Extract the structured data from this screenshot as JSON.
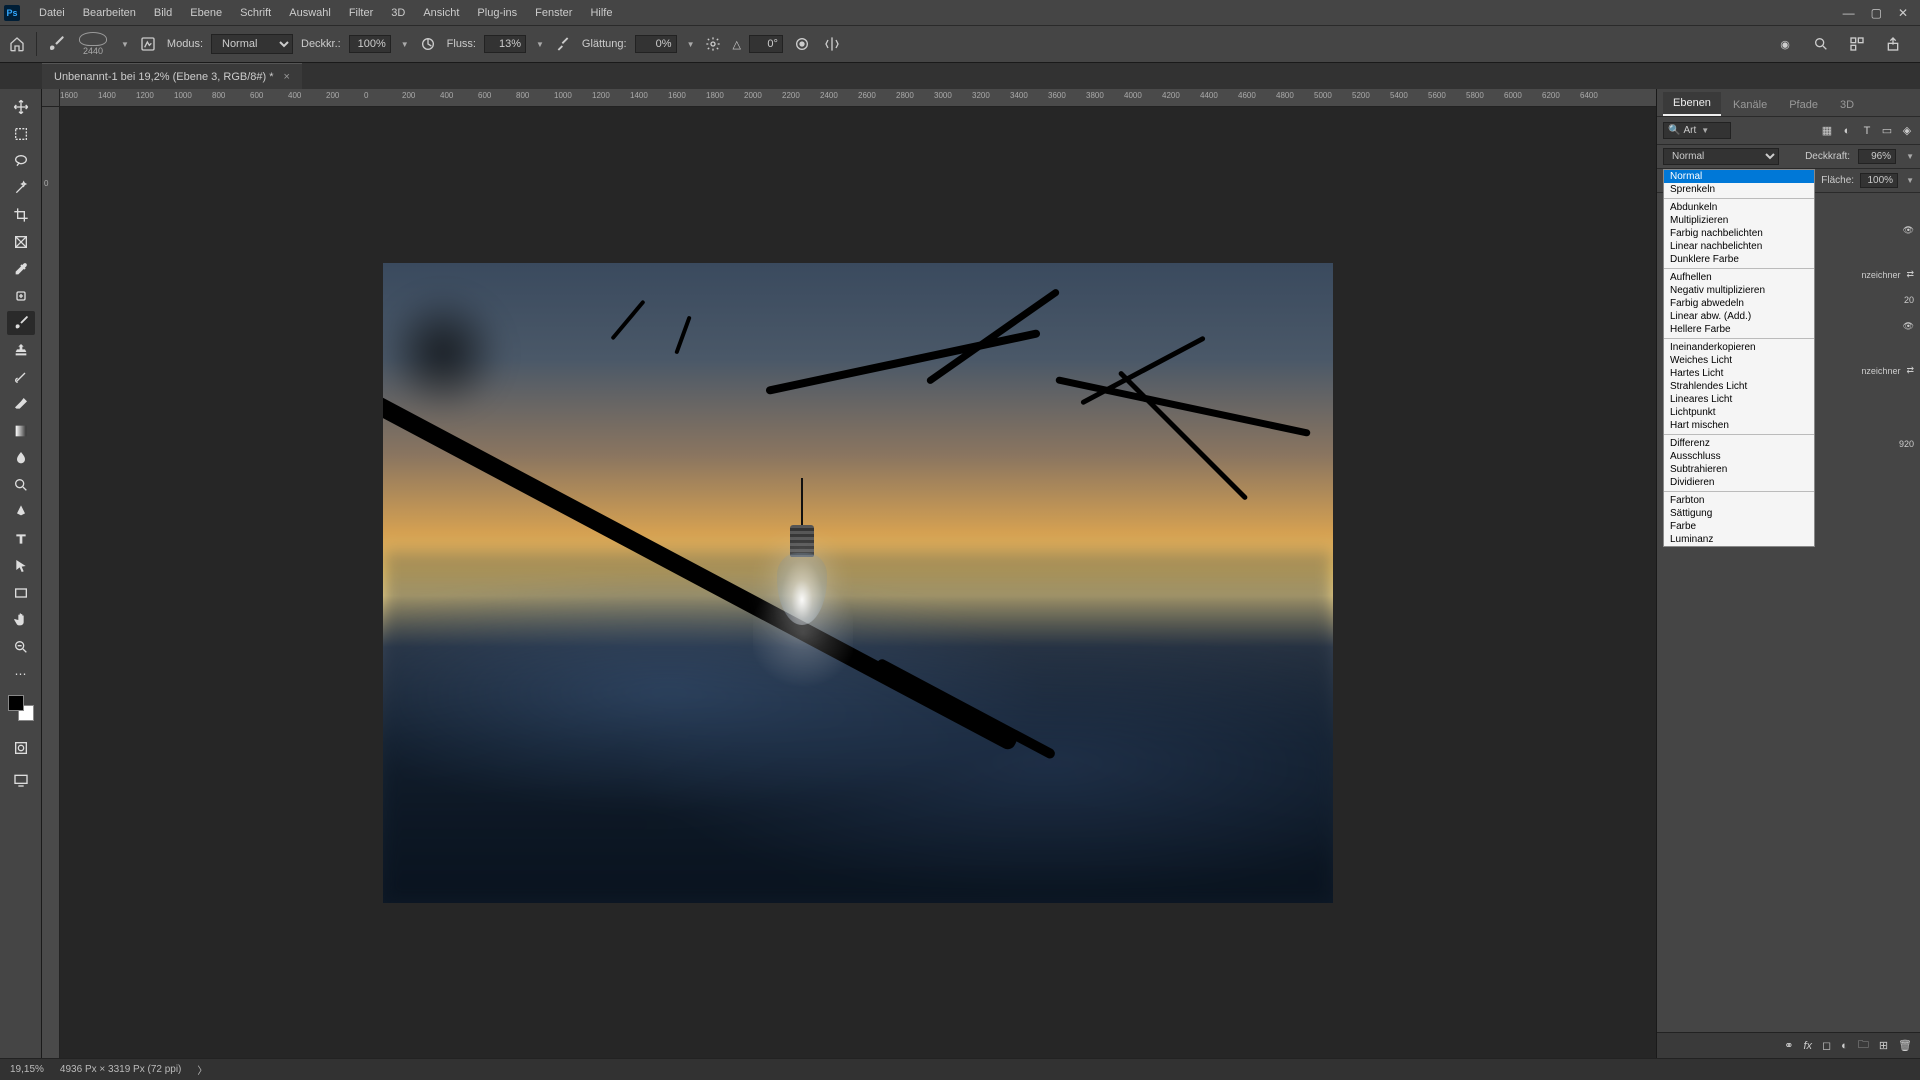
{
  "menubar": {
    "items": [
      "Datei",
      "Bearbeiten",
      "Bild",
      "Ebene",
      "Schrift",
      "Auswahl",
      "Filter",
      "3D",
      "Ansicht",
      "Plug-ins",
      "Fenster",
      "Hilfe"
    ]
  },
  "optionsbar": {
    "brush_size": "2440",
    "mode_label": "Modus:",
    "mode_value": "Normal",
    "opacity_label": "Deckkr.:",
    "opacity_value": "100%",
    "flow_label": "Fluss:",
    "flow_value": "13%",
    "smoothing_label": "Glättung:",
    "smoothing_value": "0%",
    "angle_label": "△",
    "angle_value": "0°"
  },
  "doctab": {
    "title": "Unbenannt-1 bei 19,2% (Ebene 3, RGB/8#) *"
  },
  "ruler_ticks_h": [
    "1600",
    "1400",
    "1200",
    "1000",
    "800",
    "600",
    "400",
    "200",
    "0",
    "200",
    "400",
    "600",
    "800",
    "1000",
    "1200",
    "1400",
    "1600",
    "1800",
    "2000",
    "2200",
    "2400",
    "2600",
    "2800",
    "3000",
    "3200",
    "3400",
    "3600",
    "3800",
    "4000",
    "4200",
    "4400",
    "4600",
    "4800",
    "5000",
    "5200",
    "5400",
    "5600",
    "5800",
    "6000",
    "6200",
    "6400"
  ],
  "ruler_ticks_v": [
    "0"
  ],
  "panels": {
    "tabs": [
      "Ebenen",
      "Kanäle",
      "Pfade",
      "3D"
    ],
    "active_tab": 0,
    "search_placeholder": "Art",
    "blend_current": "Normal",
    "opacity_label": "Deckkraft:",
    "opacity_value": "96%",
    "fill_label": "Fläche:",
    "fill_value": "100%",
    "blend_options": [
      [
        "Normal",
        "Sprenkeln"
      ],
      [
        "Abdunkeln",
        "Multiplizieren",
        "Farbig nachbelichten",
        "Linear nachbelichten",
        "Dunklere Farbe"
      ],
      [
        "Aufhellen",
        "Negativ multiplizieren",
        "Farbig abwedeln",
        "Linear abw. (Add.)",
        "Hellere Farbe"
      ],
      [
        "Ineinanderkopieren",
        "Weiches Licht",
        "Hartes Licht",
        "Strahlendes Licht",
        "Lineares Licht",
        "Lichtpunkt",
        "Hart mischen"
      ],
      [
        "Differenz",
        "Ausschluss",
        "Subtrahieren",
        "Dividieren"
      ],
      [
        "Farbton",
        "Sättigung",
        "Farbe",
        "Luminanz"
      ]
    ],
    "peek_labels": {
      "a": "nzeichner",
      "b": "20",
      "c": "nzeichner",
      "d": "920"
    }
  },
  "statusbar": {
    "zoom": "19,15%",
    "docinfo": "4936 Px × 3319 Px (72 ppi)"
  }
}
